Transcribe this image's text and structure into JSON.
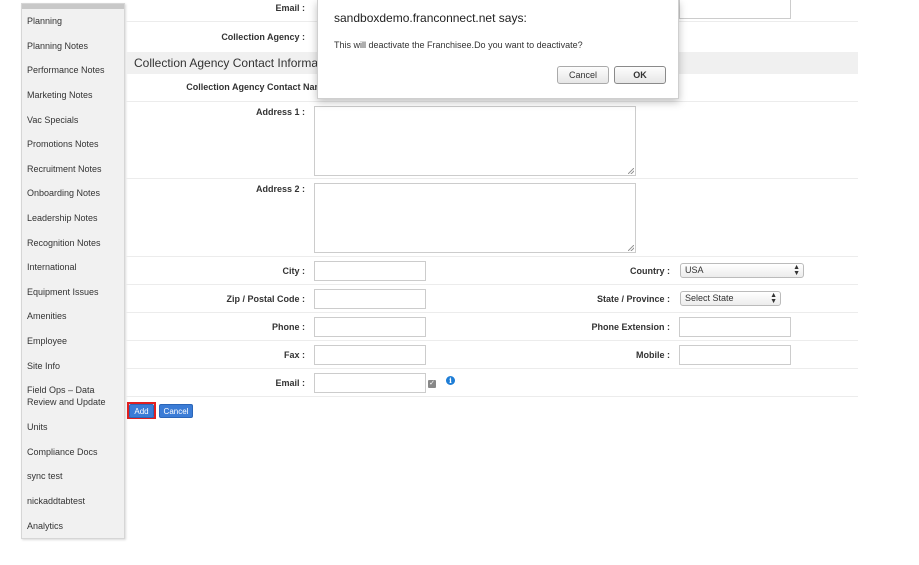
{
  "sidebar": {
    "items": [
      {
        "label": "Planning"
      },
      {
        "label": "Planning Notes"
      },
      {
        "label": "Performance Notes"
      },
      {
        "label": "Marketing Notes"
      },
      {
        "label": "Vac Specials"
      },
      {
        "label": "Promotions Notes"
      },
      {
        "label": "Recruitment Notes"
      },
      {
        "label": "Onboarding Notes"
      },
      {
        "label": "Leadership Notes"
      },
      {
        "label": "Recognition Notes"
      },
      {
        "label": "International"
      },
      {
        "label": "Equipment Issues"
      },
      {
        "label": "Amenities"
      },
      {
        "label": "Employee"
      },
      {
        "label": "Site Info"
      },
      {
        "label": "Field Ops – Data Review and Update"
      },
      {
        "label": "Units"
      },
      {
        "label": "Compliance Docs"
      },
      {
        "label": "sync test"
      },
      {
        "label": "nickaddtabtest"
      },
      {
        "label": "Analytics"
      }
    ]
  },
  "form": {
    "top_email_label": "Email :",
    "collection_agency_label": "Collection Agency :",
    "section_title": "Collection Agency Contact Informati",
    "contact_name_label": "Collection Agency Contact Name :",
    "address1_label": "Address 1 :",
    "address2_label": "Address 2 :",
    "city_label": "City :",
    "country_label": "Country :",
    "country_value": "USA",
    "zip_label": "Zip / Postal Code :",
    "state_label": "State / Province :",
    "state_value": "Select State",
    "phone_label": "Phone :",
    "phone_ext_label": "Phone Extension :",
    "fax_label": "Fax :",
    "mobile_label": "Mobile :",
    "email_label": "Email :",
    "checkbox_glyph": "✓",
    "info_glyph": "i",
    "add_button": "Add",
    "cancel_button": "Cancel"
  },
  "dialog": {
    "title": "sandboxdemo.franconnect.net says:",
    "message": "This will deactivate the Franchisee.Do you want to deactivate?",
    "cancel_label": "Cancel",
    "ok_label": "OK"
  },
  "colors": {
    "primary_button": "#3b7cd6",
    "highlight_outline": "#e02020",
    "info_icon": "#1f7ed6"
  }
}
